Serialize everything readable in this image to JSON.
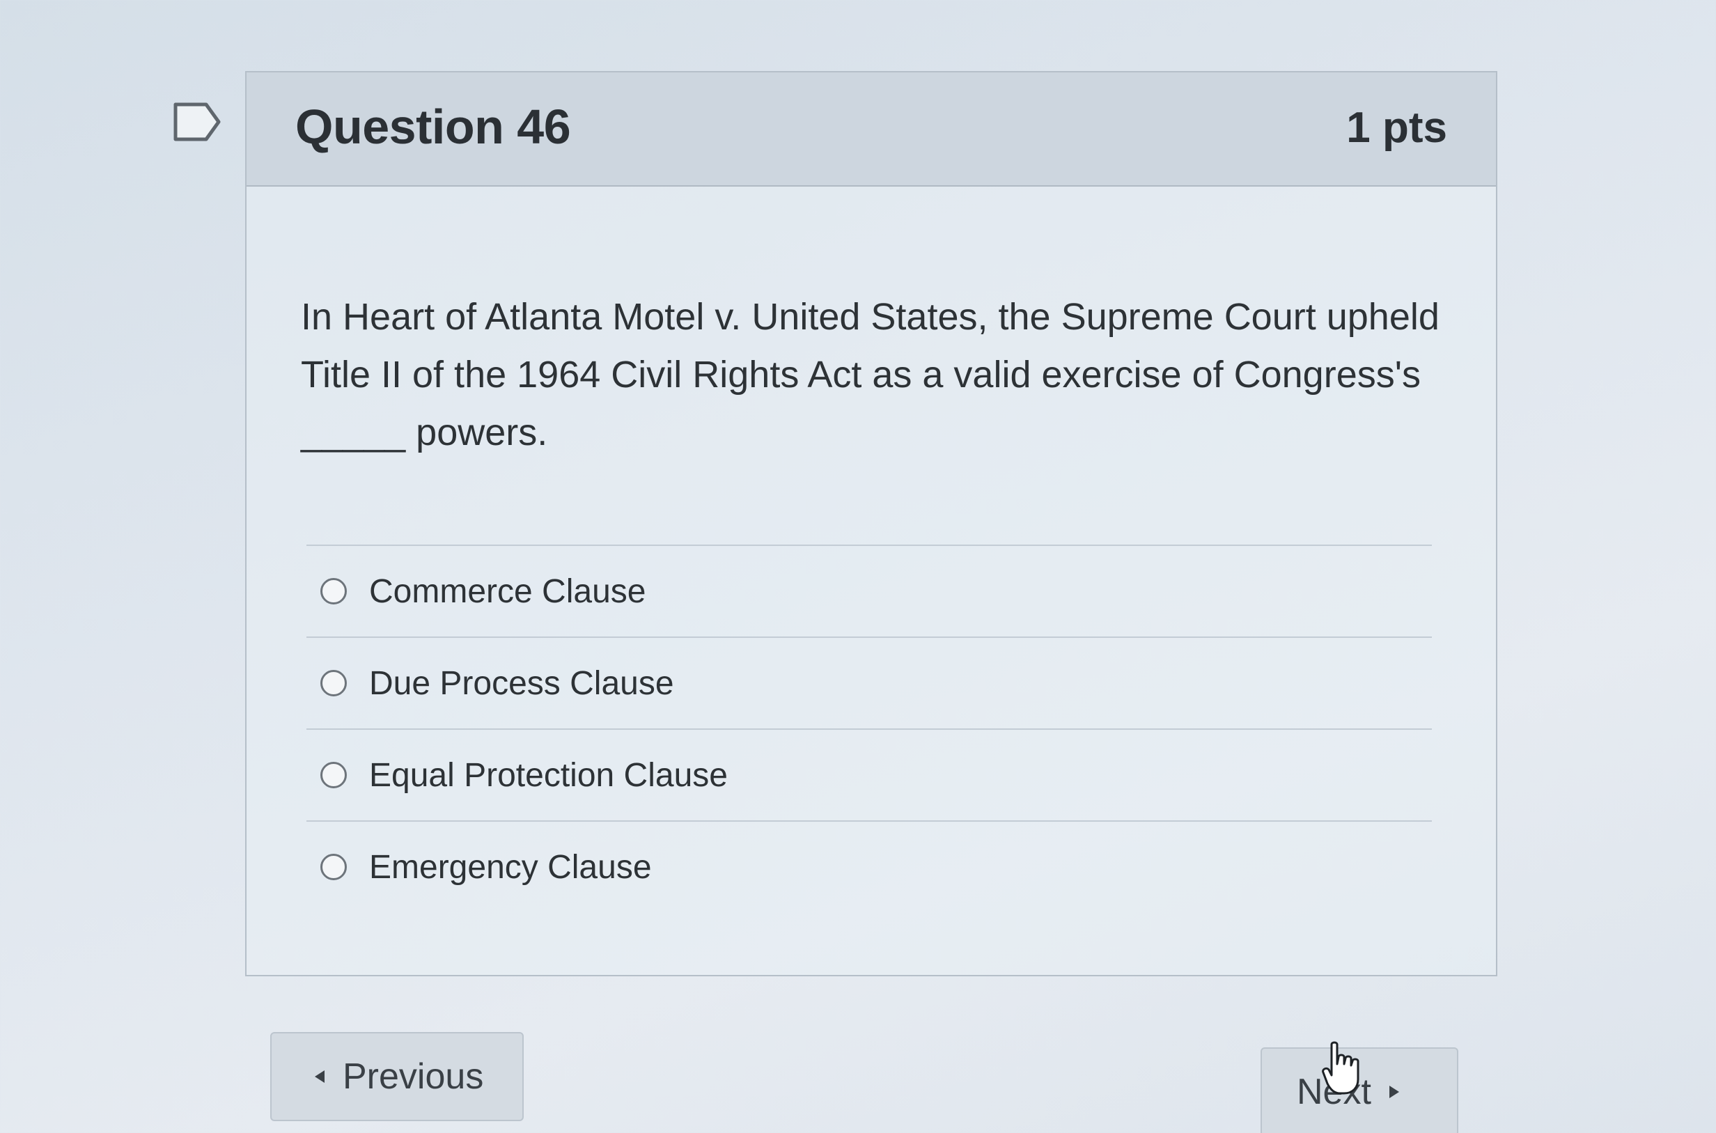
{
  "question": {
    "title": "Question 46",
    "points": "1 pts",
    "text": "In Heart of Atlanta Motel v. United States, the Supreme Court upheld Title II of the 1964 Civil Rights Act as a valid exercise of Congress's _____ powers."
  },
  "answers": [
    {
      "label": "Commerce Clause",
      "selected": false
    },
    {
      "label": "Due Process Clause",
      "selected": false
    },
    {
      "label": "Equal Protection Clause",
      "selected": false
    },
    {
      "label": "Emergency Clause",
      "selected": false
    }
  ],
  "navigation": {
    "previous_label": "Previous",
    "next_label": "Next"
  },
  "icons": {
    "flag": "flag-icon",
    "cursor": "hand-pointer-icon",
    "prev_arrow": "caret-left-icon",
    "next_arrow": "caret-right-icon"
  }
}
